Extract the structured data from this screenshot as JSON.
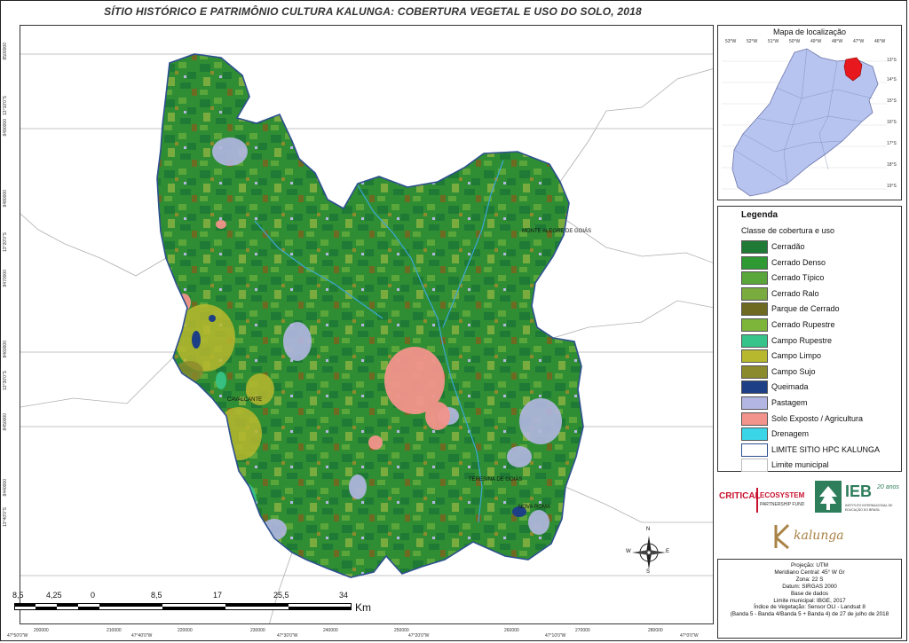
{
  "title": "SÍTIO HISTÓRICO E PATRIMÔNIO CULTURA KALUNGA: COBERTURA VEGETAL E USO DO SOLO, 2018",
  "map": {
    "y_ticks": [
      "8500000",
      "8490000",
      "8480000",
      "8470000",
      "8460000",
      "8450000",
      "8440000"
    ],
    "y_ticks_deg": [
      "13°10'0\"S",
      "13°20'0\"S",
      "13°30'0\"S",
      "13°40'0\"S"
    ],
    "x_ticks": [
      "200000",
      "210000",
      "220000",
      "230000",
      "240000",
      "250000",
      "260000",
      "270000",
      "280000"
    ],
    "x_ticks_deg": [
      "47°50'0\"W",
      "47°40'0\"W",
      "47°30'0\"W",
      "47°20'0\"W",
      "47°10'0\"W",
      "47°0'0\"W"
    ],
    "places": [
      {
        "name": "MONTE ALEGRE DE GOIÁS"
      },
      {
        "name": "CAVALCANTE"
      },
      {
        "name": "TERESINA DE GOIÁS"
      },
      {
        "name": "NOVA ROMA"
      }
    ],
    "north": {
      "n": "N",
      "s": "S",
      "e": "E",
      "w": "W"
    }
  },
  "scalebar": {
    "labels": [
      "8,5",
      "4,25",
      "0",
      "8,5",
      "17",
      "25,5",
      "34"
    ],
    "unit": "Km"
  },
  "inset": {
    "title": "Mapa de localização",
    "lon_labels": [
      "53°W",
      "52°W",
      "51°W",
      "50°W",
      "49°W",
      "48°W",
      "47°W",
      "46°W"
    ],
    "lat_labels": [
      "13°S",
      "14°S",
      "15°S",
      "16°S",
      "17°S",
      "18°S",
      "19°S"
    ],
    "state_color": "#b7c4f0",
    "highlight_color": "#e8191e"
  },
  "legend": {
    "title": "Legenda",
    "subtitle": "Classe de cobertura e uso",
    "items": [
      {
        "label": "Cerradão",
        "color": "#1f7a35"
      },
      {
        "label": "Cerrado Denso",
        "color": "#2f9a34"
      },
      {
        "label": "Cerrado Típico",
        "color": "#5aa63a"
      },
      {
        "label": "Cerrado Ralo",
        "color": "#7aab3f"
      },
      {
        "label": "Parque de Cerrado",
        "color": "#6e6a22"
      },
      {
        "label": "Cerrado Rupestre",
        "color": "#7db53a"
      },
      {
        "label": "Campo Rupestre",
        "color": "#36c48a"
      },
      {
        "label": "Campo Limpo",
        "color": "#b8b82e"
      },
      {
        "label": "Campo Sujo",
        "color": "#8b8a2c"
      },
      {
        "label": "Queimada",
        "color": "#1d3f86"
      },
      {
        "label": "Pastagem",
        "color": "#b3b6e2"
      },
      {
        "label": "Solo Exposto / Agricultura",
        "color": "#f3948c"
      },
      {
        "label": "Drenagem",
        "color": "#3ad6e8"
      },
      {
        "label": "LIMITE SITIO HPC KALUNGA",
        "color": "#2d4f8f"
      },
      {
        "label": "Limite municipal",
        "color": "#bbbbbb"
      }
    ]
  },
  "logos": {
    "cepf_a": "CRITICAL",
    "cepf_b": "ECOSYSTEM",
    "cepf_c": "PARTNERSHIP FUND",
    "ieb": "IEB",
    "ieb_years": "20 anos",
    "ieb_sub": "INSTITUTO INTERNACIONAL DE EDUCAÇÃO DO BRASIL",
    "kalunga": "kalunga"
  },
  "credits": [
    "Projeção: UTM",
    "Meridiano Central: 45° W Gr",
    "Zona: 22 S",
    "Datum: SIRGAS 2000",
    "Base de dados",
    "Limite municipal: IBGE, 2017",
    "Índice de Vegetação: Sensor OLI - Landsat 8",
    "(Banda 5 - Banda 4/Banda 5 + Banda 4) de 27 de julho de 2018"
  ]
}
